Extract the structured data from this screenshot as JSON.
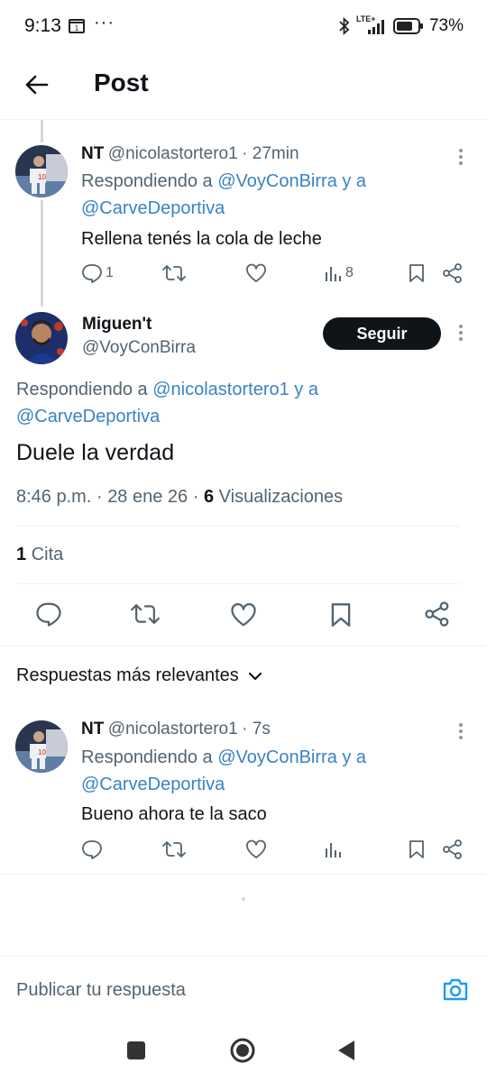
{
  "status_bar": {
    "time": "9:13",
    "date_icon_text": "1",
    "more": "···",
    "network": "LTE+",
    "battery": "73%"
  },
  "header": {
    "title": "Post"
  },
  "parent_tweet": {
    "name": "NT",
    "handle": "@nicolastortero1",
    "time": "· 27min",
    "reply_prefix": "Respondiendo a ",
    "reply_user1": "@VoyConBirra",
    "reply_and": " y a",
    "reply_user2": "@CarveDeportiva",
    "text": "Rellena tenés la cola de leche",
    "replies": "1",
    "views": "8"
  },
  "main_tweet": {
    "name": "Miguen't",
    "handle": "@VoyConBirra",
    "follow_label": "Seguir",
    "reply_prefix": "Respondiendo a ",
    "reply_user1": "@nicolastortero1",
    "reply_and": " y a",
    "reply_user2": "@CarveDeportiva",
    "text": "Duele la verdad",
    "time": "8:46 p.m.",
    "date": "28 ene 26",
    "dot": "·",
    "views_count": "6",
    "views_label": "Visualizaciones",
    "quotes_count": "1",
    "quotes_label": "Cita"
  },
  "replies_sort": {
    "label": "Respuestas más relevantes"
  },
  "reply_tweet": {
    "name": "NT",
    "handle": "@nicolastortero1",
    "time": "· 7s",
    "reply_prefix": "Respondiendo a ",
    "reply_user1": "@VoyConBirra",
    "reply_and": " y a",
    "reply_user2": "@CarveDeportiva",
    "text": "Bueno ahora te la saco"
  },
  "composer": {
    "placeholder": "Publicar tu respuesta"
  },
  "colors": {
    "link": "#1d9bf0",
    "text": "#0f1419",
    "muted": "#536471",
    "button": "#0f1419"
  },
  "icons": [
    "back-arrow-icon",
    "reply-icon",
    "retweet-icon",
    "like-icon",
    "views-icon",
    "bookmark-icon",
    "share-icon",
    "more-icon",
    "camera-icon",
    "chevron-down-icon"
  ]
}
